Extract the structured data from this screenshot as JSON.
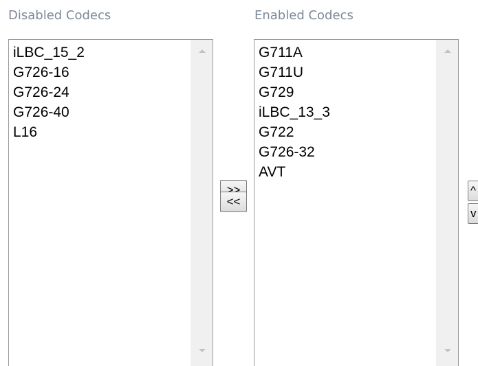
{
  "disabled": {
    "heading": "Disabled Codecs",
    "items": [
      "iLBC_15_2",
      "G726-16",
      "G726-24",
      "G726-40",
      "L16"
    ]
  },
  "enabled": {
    "heading": "Enabled Codecs",
    "items": [
      "G711A",
      "G711U",
      "G729",
      "iLBC_13_3",
      "G722",
      "G726-32",
      "AVT"
    ]
  },
  "buttons": {
    "add_label": ">>",
    "remove_label": "<<",
    "up_label": "^",
    "down_label": "v"
  },
  "colors": {
    "heading": "#7d8996",
    "scrollbar_track": "#f0f0f0",
    "border": "#9a9a9a"
  }
}
